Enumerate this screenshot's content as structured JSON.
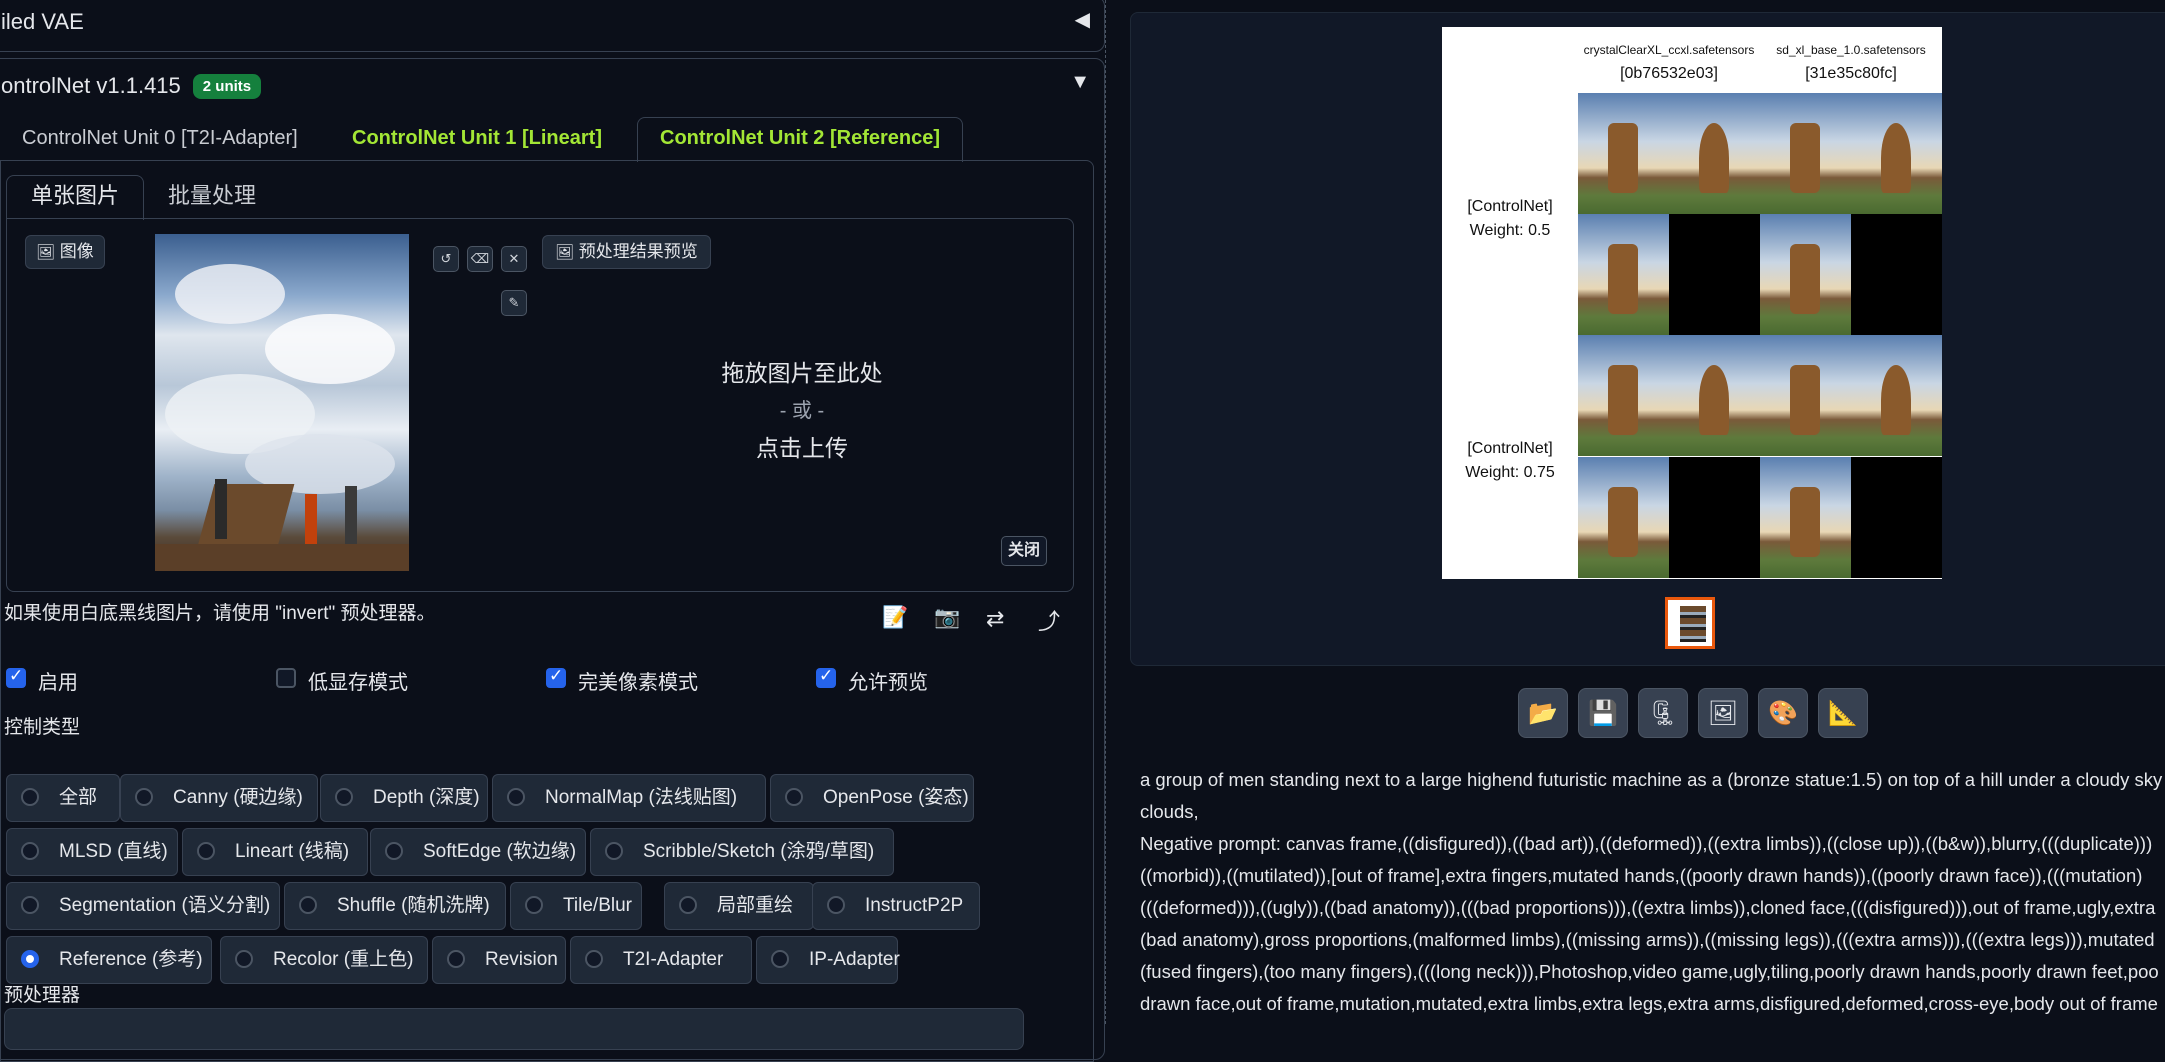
{
  "vae_accordion": {
    "title": "iled VAE"
  },
  "controlnet": {
    "title": "ontrolNet v1.1.415",
    "badge": "2 units",
    "tabs": [
      {
        "label": "ControlNet Unit 0 [T2I-Adapter]"
      },
      {
        "label": "ControlNet Unit 1 [Lineart]"
      },
      {
        "label": "ControlNet Unit 2 [Reference]"
      }
    ],
    "subtabs": [
      {
        "label": "单张图片"
      },
      {
        "label": "批量处理"
      }
    ],
    "image_label": "图像",
    "preview_label": "预处理结果预览",
    "drop_text": "拖放图片至此处",
    "or_text": "- 或 -",
    "upload_text": "点击上传",
    "close_label": "关闭",
    "invert_hint": "如果使用白底黑线图片，请使用 \"invert\" 预处理器。",
    "checkboxes": [
      {
        "label": "启用",
        "checked": true
      },
      {
        "label": "低显存模式",
        "checked": false
      },
      {
        "label": "完美像素模式",
        "checked": true
      },
      {
        "label": "允许预览",
        "checked": true
      }
    ],
    "control_type_label": "控制类型",
    "control_types": [
      {
        "label": "全部",
        "selected": false
      },
      {
        "label": "Canny (硬边缘)",
        "selected": false
      },
      {
        "label": "Depth (深度)",
        "selected": false
      },
      {
        "label": "NormalMap (法线贴图)",
        "selected": false
      },
      {
        "label": "OpenPose (姿态)",
        "selected": false
      },
      {
        "label": "MLSD (直线)",
        "selected": false
      },
      {
        "label": "Lineart (线稿)",
        "selected": false
      },
      {
        "label": "SoftEdge (软边缘)",
        "selected": false
      },
      {
        "label": "Scribble/Sketch (涂鸦/草图)",
        "selected": false
      },
      {
        "label": "Segmentation (语义分割)",
        "selected": false
      },
      {
        "label": "Shuffle (随机洗牌)",
        "selected": false
      },
      {
        "label": "Tile/Blur",
        "selected": false
      },
      {
        "label": "局部重绘",
        "selected": false
      },
      {
        "label": "InstructP2P",
        "selected": false
      },
      {
        "label": "Reference (参考)",
        "selected": true
      },
      {
        "label": "Recolor (重上色)",
        "selected": false
      },
      {
        "label": "Revision",
        "selected": false
      },
      {
        "label": "T2I-Adapter",
        "selected": false
      },
      {
        "label": "IP-Adapter",
        "selected": false
      }
    ],
    "preprocessor_label": "预处理器"
  },
  "grid": {
    "col_headers": [
      {
        "model": "crystalClearXL_ccxl.safetensors",
        "hash": "[0b76532e03]"
      },
      {
        "model": "sd_xl_base_1.0.safetensors",
        "hash": "[31e35c80fc]"
      }
    ],
    "row_headers": [
      {
        "line1": "[ControlNet]",
        "line2": "Weight: 0.5"
      },
      {
        "line1": "[ControlNet]",
        "line2": "Weight: 0.75"
      }
    ]
  },
  "toolbar_icons": [
    "folder-icon",
    "save-icon",
    "zip-icon",
    "image-icon",
    "palette-icon",
    "ruler-icon"
  ],
  "prompt_lines": [
    "a group of men standing next to a large highend futuristic machine as a (bronze statue:1.5) on top of a hill under a cloudy sky",
    "clouds,",
    "Negative prompt: canvas frame,((disfigured)),((bad art)),((deformed)),((extra limbs)),((close up)),((b&w)),blurry,(((duplicate)))",
    "((morbid)),((mutilated)),[out of frame],extra fingers,mutated hands,((poorly drawn hands)),((poorly drawn face)),(((mutation)",
    "(((deformed))),((ugly)),((bad anatomy)),(((bad proportions))),((extra limbs)),cloned face,(((disfigured))),out of frame,ugly,extra",
    "(bad anatomy),gross proportions,(malformed limbs),((missing arms)),((missing legs)),(((extra arms))),(((extra legs))),mutated",
    "(fused fingers),(too many fingers),(((long neck))),Photoshop,video game,ugly,tiling,poorly drawn hands,poorly drawn feet,poo",
    "drawn face,out of frame,mutation,mutated,extra limbs,extra legs,extra arms,disfigured,deformed,cross-eye,body out of frame"
  ]
}
